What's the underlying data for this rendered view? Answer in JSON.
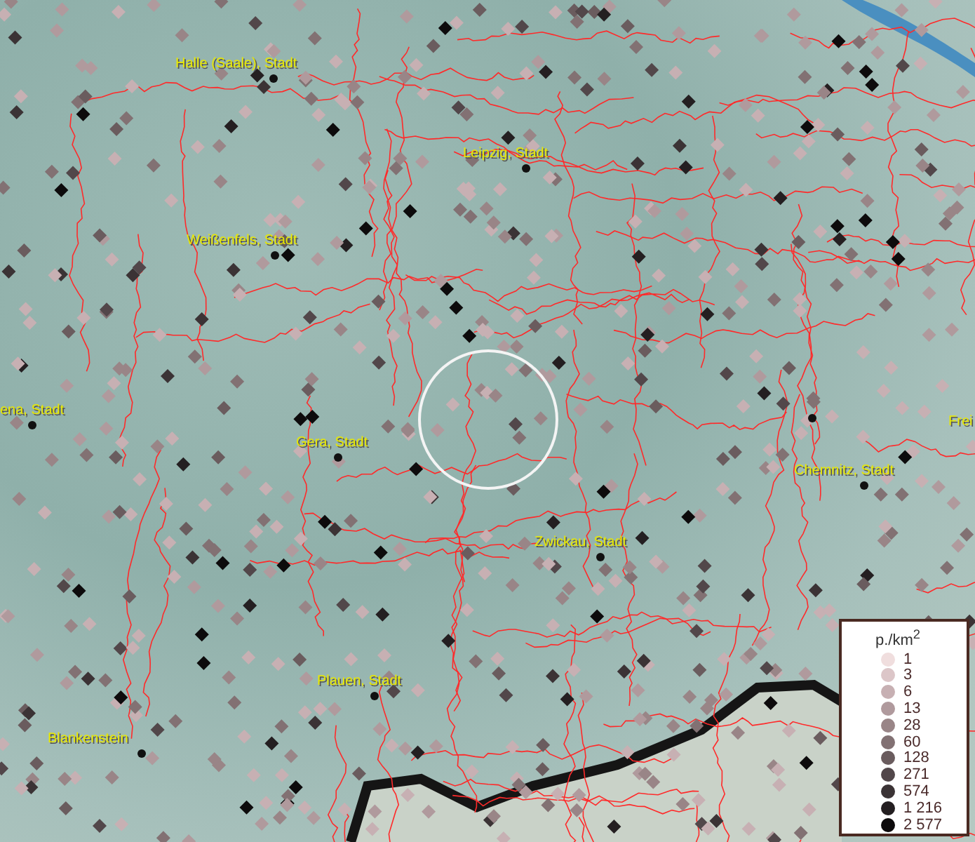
{
  "map": {
    "places": [
      {
        "name": "Halle (Saale), Stadt"
      },
      {
        "name": "Leipzig, Stadt"
      },
      {
        "name": "Weißenfels, Stadt"
      },
      {
        "name": "ena, Stadt"
      },
      {
        "name": "Gera, Stadt"
      },
      {
        "name": "Chemnitz, Stadt"
      },
      {
        "name": "Frei"
      },
      {
        "name": "Zwickau, Stadt"
      },
      {
        "name": "Plauen, Stadt"
      },
      {
        "name": "Blankenstein"
      }
    ]
  },
  "legend": {
    "title": "p./km$^{2}$",
    "items": [
      {
        "label": "1",
        "color": "#f0dede"
      },
      {
        "label": "3",
        "color": "#dcc6c8"
      },
      {
        "label": "6",
        "color": "#c7b0b3"
      },
      {
        "label": "13",
        "color": "#b09a9d"
      },
      {
        "label": "28",
        "color": "#998587"
      },
      {
        "label": "60",
        "color": "#827173"
      },
      {
        "label": "128",
        "color": "#6a5c5e"
      },
      {
        "label": "271",
        "color": "#52474a"
      },
      {
        "label": "574",
        "color": "#3b3335"
      },
      {
        "label": "1 216",
        "color": "#241f21"
      },
      {
        "label": "2 577",
        "color": "#0d0b0c"
      }
    ]
  }
}
